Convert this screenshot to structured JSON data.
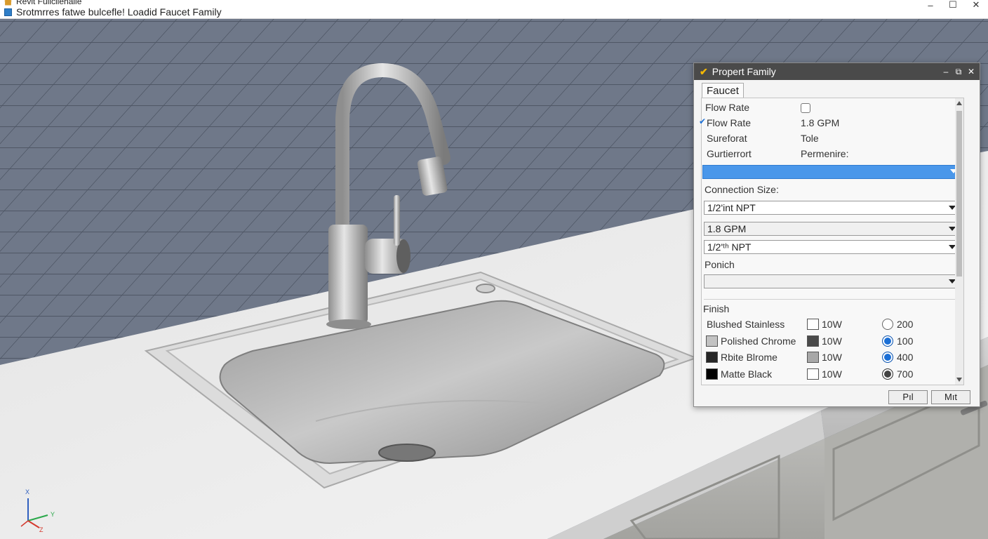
{
  "window": {
    "app_line": "Revit Fulicilehalle",
    "title": "Srotmrres fatwe bulcefle! Loadid Faucet Family",
    "controls": {
      "minimize": "–",
      "maximize": "☐",
      "close": "✕"
    }
  },
  "panel": {
    "title": "Propert Family",
    "controls": {
      "minimize": "–",
      "restore": "⧉",
      "close": "✕"
    },
    "tab": "Faucet",
    "rows": [
      {
        "label": "Flow Rate",
        "value": ""
      },
      {
        "label": "Flow Rate",
        "value": "1.8 GPM",
        "marker": "✔"
      },
      {
        "label": "Sureforat",
        "value": "Tole"
      },
      {
        "label": "Gurtierrort",
        "value": "Permenire:"
      }
    ],
    "connection_label": "Connection Size:",
    "dropdowns": [
      "1/2'int NPT",
      "1.8 GPM",
      "1/2'ᵗʰ NPT"
    ],
    "ponich_label": "Ponich",
    "ponich_value": "",
    "finish_label": "Finish",
    "finish_rows": [
      {
        "name": "Blushed Stainless",
        "swatch": "#ffffff",
        "wattage": "10W",
        "wattage_swatch": "#ffffff",
        "value": "200",
        "radio": "empty"
      },
      {
        "name": "Polished Chrome",
        "swatch": "#c2c2c2",
        "wattage": "10W",
        "wattage_swatch": "#4a4a4a",
        "value": "100",
        "radio": "selected"
      },
      {
        "name": "Rbite Blrome",
        "swatch": "#262626",
        "wattage": "10W",
        "wattage_swatch": "#a8a8a8",
        "value": "400",
        "radio": "selected"
      },
      {
        "name": "Matte Black",
        "swatch": "#000000",
        "wattage": "10W",
        "wattage_swatch": "#ffffff",
        "value": "700",
        "radio": "dark"
      }
    ],
    "buttons": {
      "left": "Pıl",
      "right": "Mıt"
    }
  },
  "axes": {
    "x": "X",
    "y": "Y",
    "z": "Z"
  },
  "colors": {
    "accent": "#4a97ea",
    "radio": "#1b6fd6",
    "panel_title": "#4a4a4a"
  }
}
